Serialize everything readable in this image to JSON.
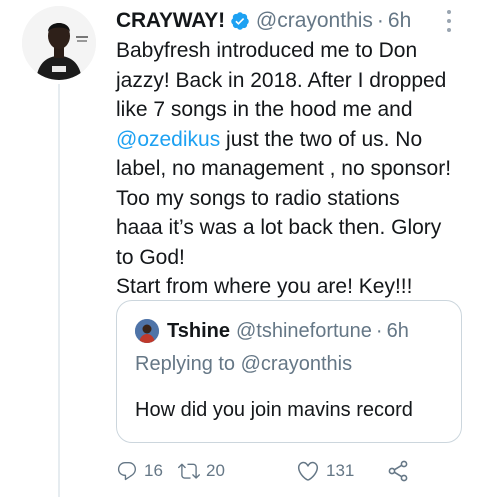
{
  "tweet": {
    "display_name": "CRAYWAY!",
    "handle": "@crayonthis",
    "separator": "·",
    "time": "6h",
    "lines": [
      "Babyfresh introduced me to Don",
      "jazzy! Back in 2018. After I dropped",
      "like 7 songs in the hood me and",
      " just the two of us. No",
      "label, no management , no sponsor!",
      "Too my songs to radio stations",
      "haaa it’s was a lot back then. Glory",
      "to God!",
      "Start from where you are! Key!!!"
    ],
    "mention": "@ozedikus"
  },
  "quote": {
    "display_name": "Tshine",
    "handle": "@tshinefortune",
    "separator": "·",
    "time": "6h",
    "replying_to": "Replying to @crayonthis",
    "text": "How did you join mavins record"
  },
  "actions": {
    "replies": "16",
    "retweets": "20",
    "likes": "131"
  },
  "colors": {
    "accent": "#1da1f2",
    "secondary_text": "#657786",
    "border": "#ccd6dd"
  },
  "icons": [
    "verified-badge-icon",
    "more-icon",
    "reply-icon",
    "retweet-icon",
    "like-icon",
    "share-icon"
  ]
}
